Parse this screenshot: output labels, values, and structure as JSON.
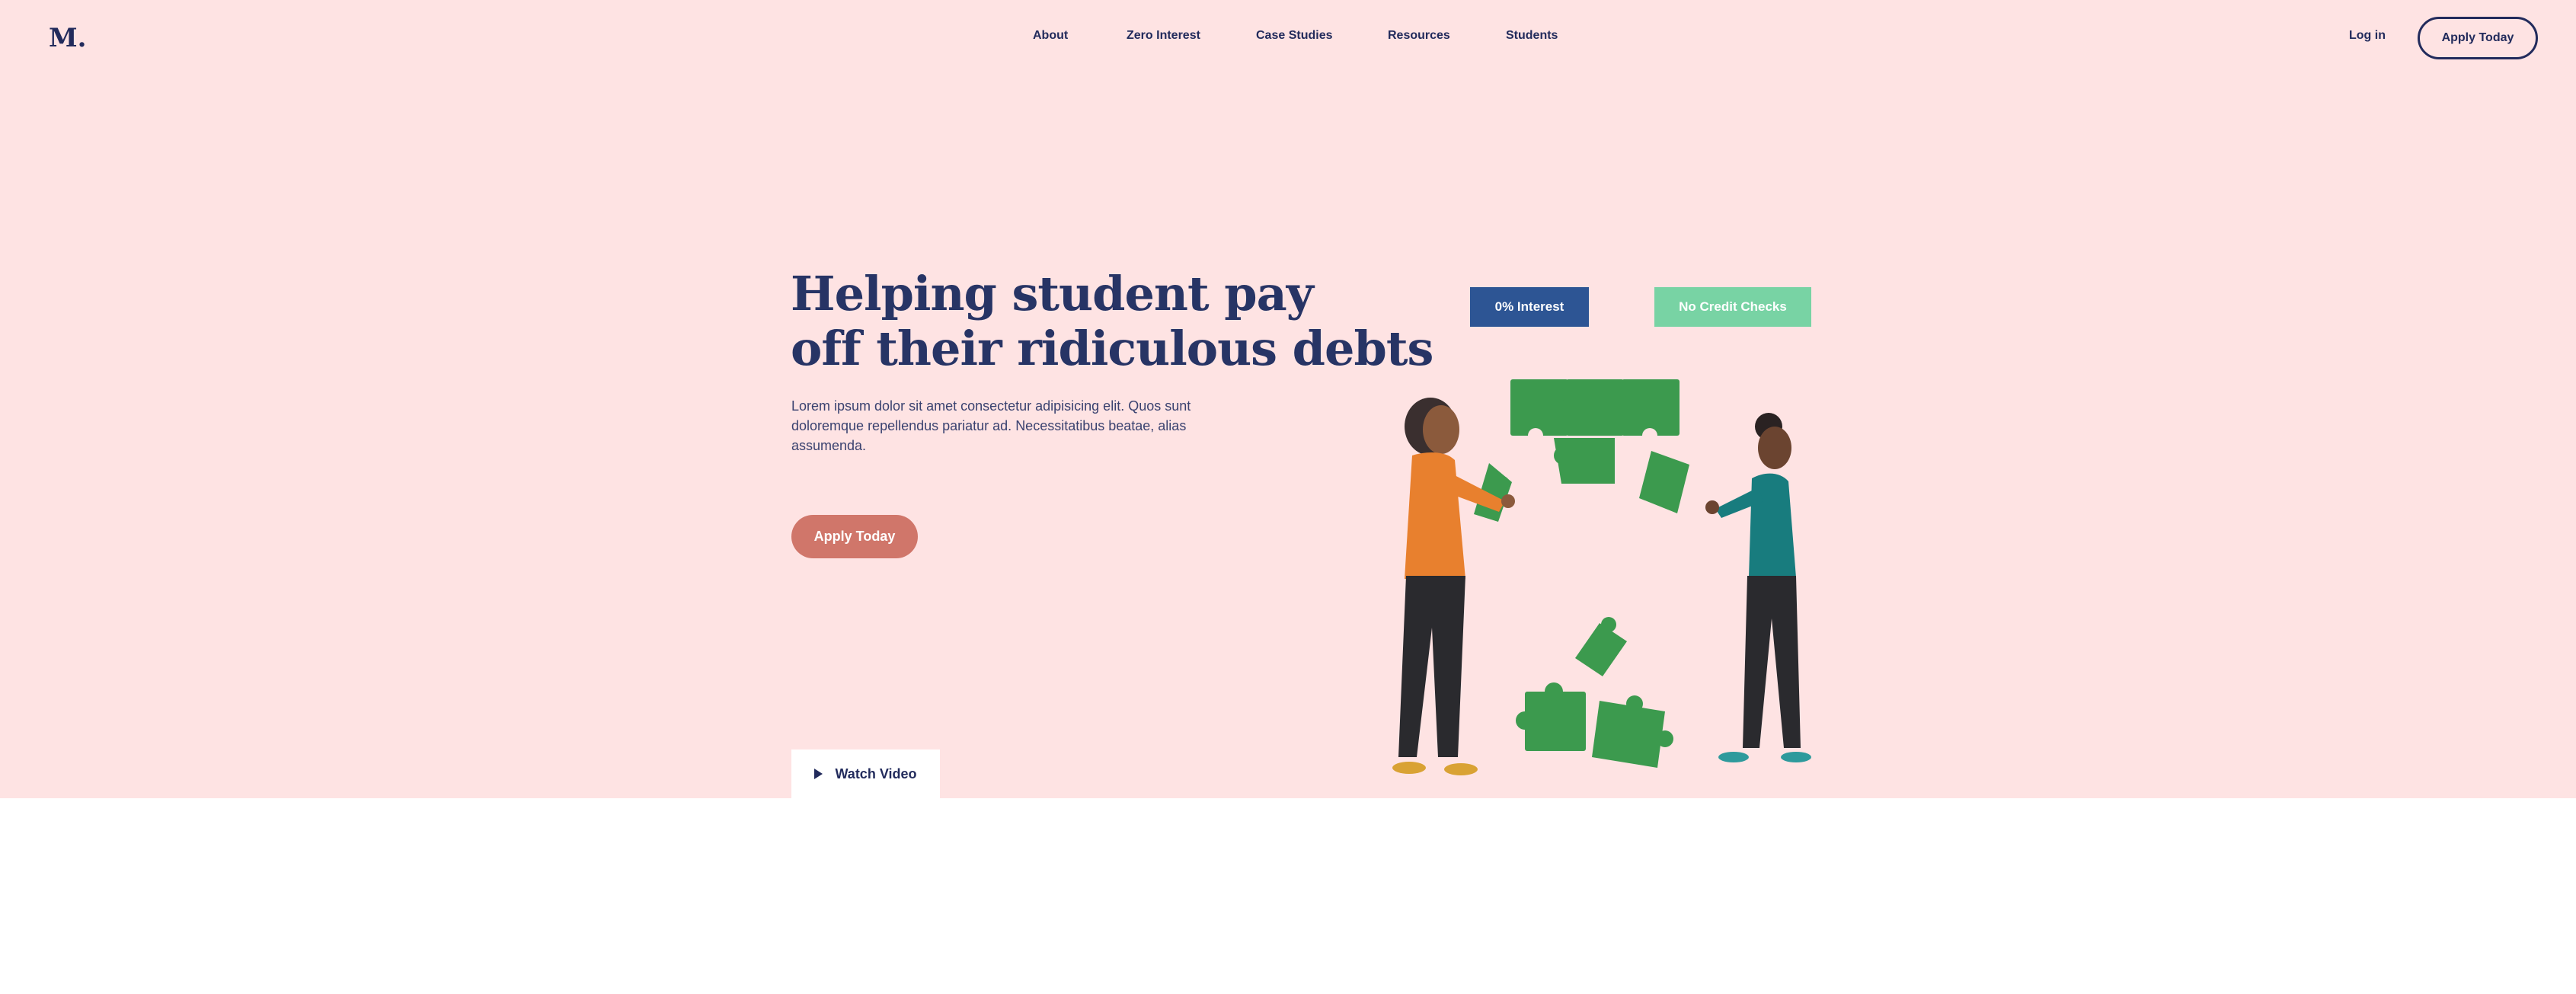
{
  "brand": {
    "logo": "M."
  },
  "nav": {
    "items": [
      {
        "label": "About"
      },
      {
        "label": "Zero Interest"
      },
      {
        "label": "Case Studies"
      },
      {
        "label": "Resources"
      },
      {
        "label": "Students"
      }
    ],
    "login_label": "Log in",
    "apply_label": "Apply Today"
  },
  "hero": {
    "headline_line1": "Helping student pay",
    "headline_line2": "off their ridiculous debts",
    "lead": "Lorem ipsum dolor sit amet consectetur adipisicing elit. Quos sunt doloremque repellendus pariatur ad. Necessitatibus beatae, alias assumenda.",
    "cta_label": "Apply Today",
    "video_label": "Watch Video"
  },
  "badges": {
    "interest": "0% Interest",
    "credit": "No Credit Checks"
  },
  "colors": {
    "hero_background": "#fee3e3",
    "navy": "#222b5c",
    "cta": "#d0766a",
    "badge_blue": "#2d5594",
    "badge_green": "#78d3a4",
    "puzzle_green": "#3c9a4e"
  },
  "icons": {
    "play": "play-icon",
    "illustration": "people-assembling-puzzle-illustration"
  }
}
